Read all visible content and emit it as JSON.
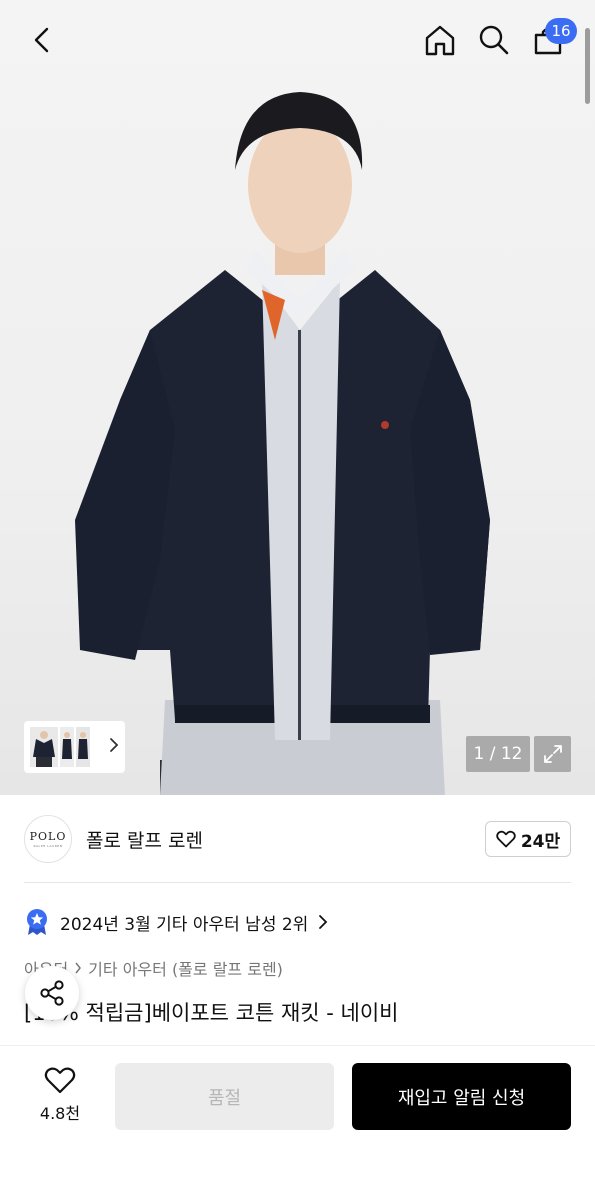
{
  "header": {
    "back_icon": "chevron-left-icon",
    "home_icon": "home-icon",
    "search_icon": "search-icon",
    "cart_icon": "shopping-bag-icon",
    "cart_count": "16"
  },
  "gallery": {
    "counter": "1 / 12",
    "expand_icon": "expand-icon",
    "thumbnails_chevron_icon": "chevron-right-icon"
  },
  "brand": {
    "logo_text": "POLO",
    "logo_subtext": "RALPH LAUREN",
    "name": "폴로 랄프 로렌",
    "like_count": "24만"
  },
  "ranking": {
    "text": "2024년 3월 기타 아우터 남성 2위"
  },
  "breadcrumb": {
    "category": "아우터",
    "subcategory": "기타 아우터 (폴로 랄프 로렌)"
  },
  "product": {
    "title": "[10% 적립금]베이포트 코튼 재킷 - 네이비"
  },
  "bottom": {
    "wish_count": "4.8천",
    "soldout_label": "품절",
    "restock_label": "재입고 알림 신청"
  },
  "colors": {
    "badge": "#3a6cf4",
    "ranking_star": "#3a6cf4",
    "primary_button": "#000000"
  }
}
